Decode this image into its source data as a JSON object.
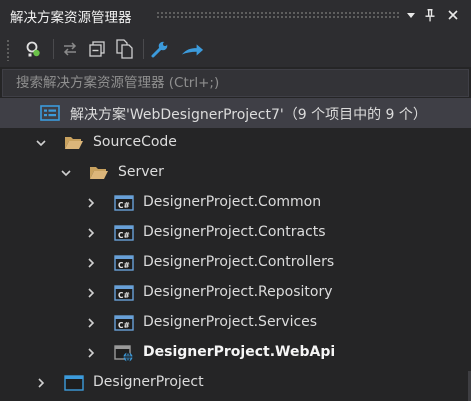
{
  "window": {
    "title": "解决方案资源管理器",
    "icons": [
      "dropdown-arrow-icon",
      "pin-icon",
      "close-icon"
    ]
  },
  "toolbar": {
    "buttons": [
      "home-sync-icon",
      "sync-with-active-document-icon",
      "collapse-all-icon",
      "show-all-files-icon",
      "properties-wrench-icon",
      "preview-selected-items-icon"
    ]
  },
  "search": {
    "placeholder": "搜索解决方案资源管理器 (Ctrl+;)"
  },
  "tree": {
    "solution": {
      "label": "解决方案'WebDesignerProject7'（9 个项目中的 9 个）",
      "icon": "solution-icon"
    },
    "source_folder": {
      "label": "SourceCode",
      "icon": "folder-open-icon",
      "expanded": true
    },
    "server_folder": {
      "label": "Server",
      "icon": "folder-open-icon",
      "expanded": true
    },
    "projects": [
      {
        "label": "DesignerProject.Common",
        "icon": "csharp-project-icon"
      },
      {
        "label": "DesignerProject.Contracts",
        "icon": "csharp-project-icon"
      },
      {
        "label": "DesignerProject.Controllers",
        "icon": "csharp-project-icon"
      },
      {
        "label": "DesignerProject.Repository",
        "icon": "csharp-project-icon"
      },
      {
        "label": "DesignerProject.Services",
        "icon": "csharp-project-icon"
      },
      {
        "label": "DesignerProject.WebApi",
        "icon": "web-project-icon",
        "startup": true
      }
    ],
    "designer_project": {
      "label": "DesignerProject",
      "icon": "web-app-project-icon"
    }
  },
  "colors": {
    "background": "#252526",
    "selection": "#3f3f46",
    "folder": "#dcb67a",
    "csharp_project": "#68a0d8",
    "accent_blue": "#3c9bdc"
  }
}
